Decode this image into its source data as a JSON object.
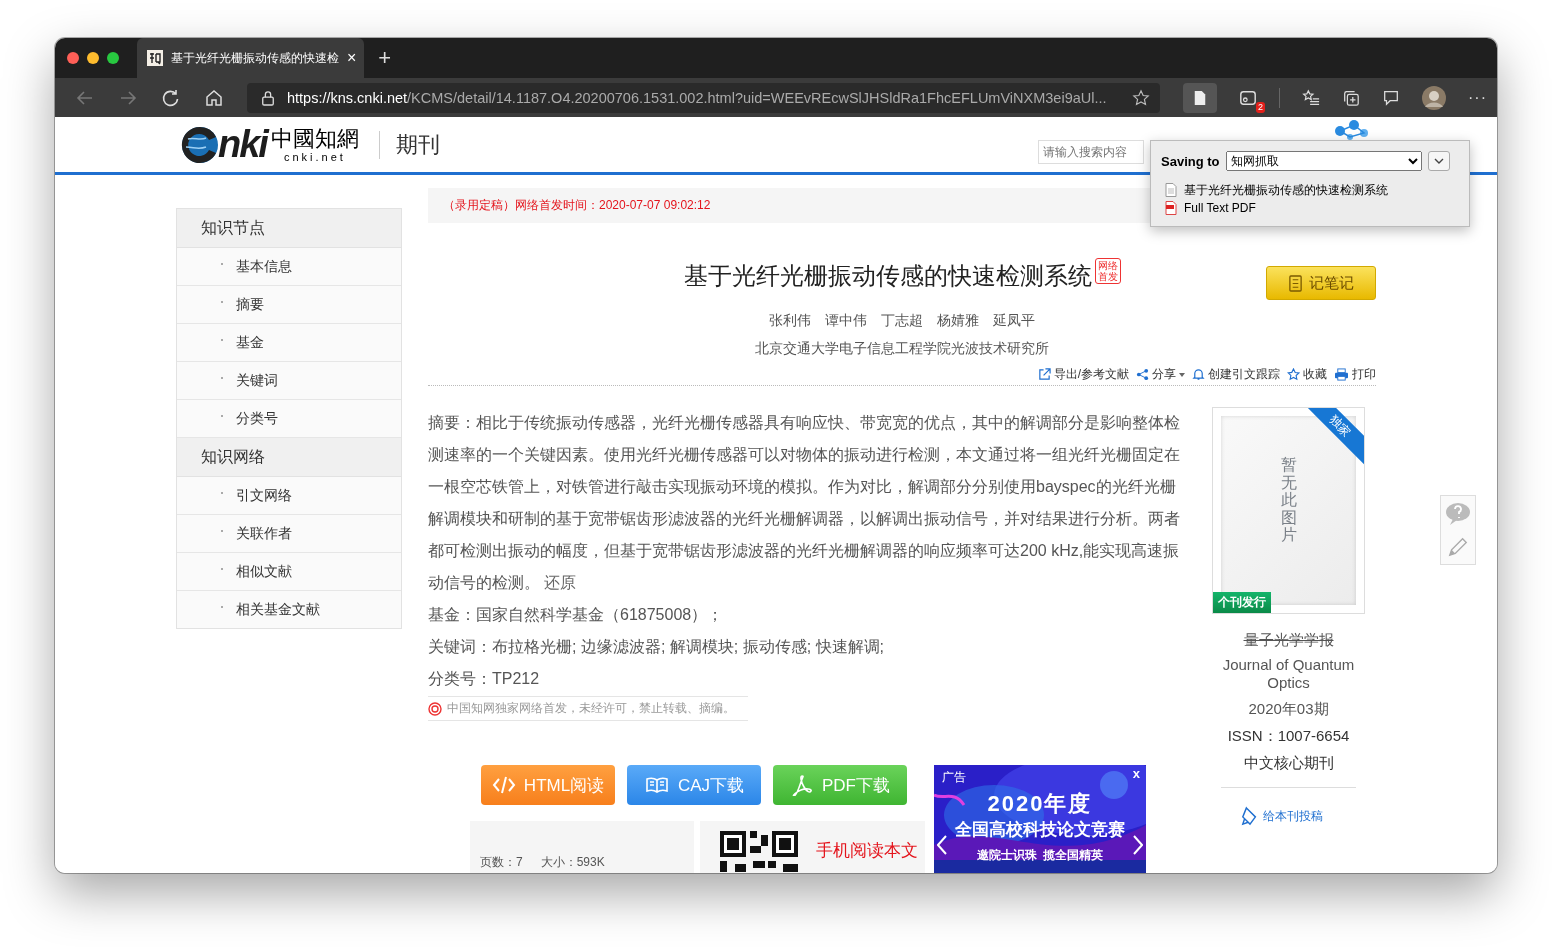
{
  "browser": {
    "tab": {
      "title": "基于光纤光栅振动传感的快速检",
      "close": "×"
    },
    "new_tab": "+",
    "url": {
      "host": "https://kns.cnki.net",
      "path": "/KCMS/detail/14.1187.O4.20200706.1531.002.html?uid=WEEvREcwSlJHSldRa1FhcEFLUmViNXM3ei9aUl..."
    },
    "extension_badge": "2",
    "more": "···"
  },
  "header": {
    "logo": {
      "mark": "nki",
      "cn": "中國知網",
      "domain": "cnki.net"
    },
    "section": "期刊",
    "search": {
      "placeholder": "请输入搜索内容"
    }
  },
  "save_popup": {
    "label": "Saving to",
    "folder": "知网抓取",
    "items": [
      {
        "kind": "document",
        "text": "基于光纤光栅振动传感的快速检测系统"
      },
      {
        "kind": "pdf",
        "text": "Full Text PDF"
      }
    ]
  },
  "sidebar": {
    "sections": [
      {
        "title": "知识节点",
        "items": [
          "基本信息",
          "摘要",
          "基金",
          "关键词",
          "分类号"
        ]
      },
      {
        "title": "知识网络",
        "items": [
          "引文网络",
          "关联作者",
          "相似文献",
          "相关基金文献"
        ]
      }
    ]
  },
  "notice_bar": "（录用定稿）网络首发时间：2020-07-07 09:02:12",
  "article": {
    "title": "基于光纤光栅振动传感的快速检测系统",
    "badge": "网络首发",
    "note_button": "记笔记",
    "authors": [
      "张利伟",
      "谭中伟",
      "丁志超",
      "杨婧雅",
      "延凤平"
    ],
    "affiliation": "北京交通大学电子信息工程学院光波技术研究所",
    "actions": [
      {
        "kind": "export",
        "label": "导出/参考文献"
      },
      {
        "kind": "share",
        "label": "分享"
      },
      {
        "kind": "track",
        "label": "创建引文跟踪"
      },
      {
        "kind": "favorite",
        "label": "收藏"
      },
      {
        "kind": "print",
        "label": "打印"
      }
    ],
    "abstract": {
      "label": "摘要：",
      "text": "相比于传统振动传感器，光纤光栅传感器具有响应快、带宽宽的优点，其中的解调部分是影响整体检测速率的一个关键因素。使用光纤光栅传感器可以对物体的振动进行检测，本文通过将一组光纤光栅固定在一根空芯铁管上，对铁管进行敲击实现振动环境的模拟。作为对比，解调部分分别使用bayspec的光纤光栅解调模块和研制的基于宽带锯齿形滤波器的光纤光栅解调器，以解调出振动信号，并对结果进行分析。两者都可检测出振动的幅度，但基于宽带锯齿形滤波器的光纤光栅解调器的响应频率可达200 kHz,能实现高速振动信号的检测。",
      "link": "还原"
    },
    "fields": [
      {
        "label": "基金：",
        "value": "国家自然科学基金（61875008）；"
      },
      {
        "label": "关键词：",
        "value": "布拉格光栅; 边缘滤波器; 解调模块; 振动传感; 快速解调;"
      },
      {
        "label": "分类号：",
        "value": "TP212"
      }
    ],
    "copyright": "中国知网独家网络首发，未经许可，禁止转载、摘编。"
  },
  "downloads": [
    {
      "kind": "html",
      "label": "HTML阅读"
    },
    {
      "kind": "caj",
      "label": "CAJ下载"
    },
    {
      "kind": "pdf",
      "label": "PDF下载"
    }
  ],
  "file_info": {
    "pages": "页数：7",
    "size": "大小：593K"
  },
  "mobile": {
    "label": "手机阅读本文"
  },
  "ad": {
    "tag": "广告",
    "close": "x",
    "headline": "2020年度",
    "title": "全国高校科技论文竞赛",
    "slogan": "邀院士识珠  揽全国精英"
  },
  "journal": {
    "cover_text": "暂无此图片",
    "corner_tag": "独家",
    "cover_tag": "个刊发行",
    "name_cn": "量子光学学报",
    "name_en": "Journal of Quantum Optics",
    "issue": "2020年03期",
    "issn": "ISSN：1007-6654",
    "rank": "中文核心期刊",
    "submit_link": "给本刊投稿"
  }
}
